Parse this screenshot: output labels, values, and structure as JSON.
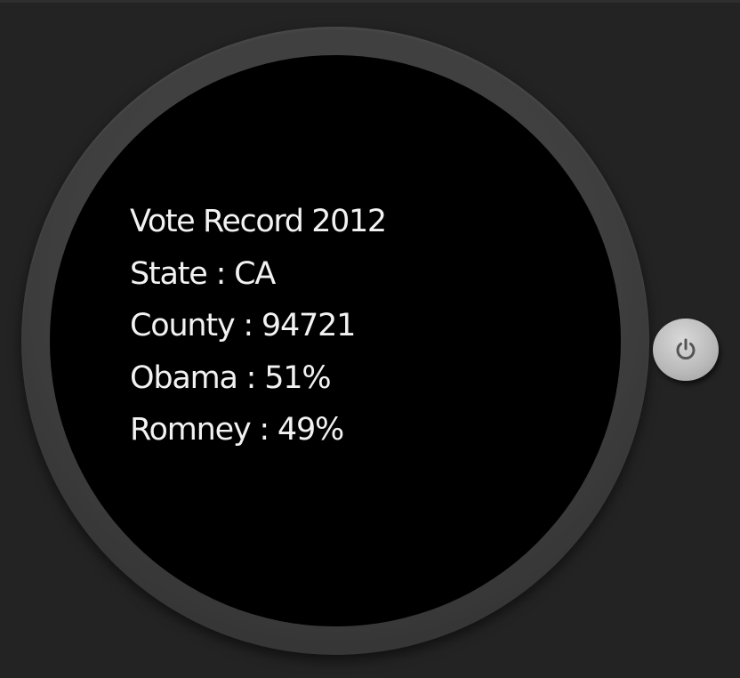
{
  "watch": {
    "lines": [
      "Vote Record 2012",
      "State : CA",
      "County : 94721",
      "Obama : 51%",
      "Romney : 49%"
    ]
  },
  "controls": {
    "power_button_icon": "power-icon"
  },
  "colors": {
    "background": "#232323",
    "bezel": "#404040",
    "screen": "#000000",
    "text": "#f2f2f2",
    "button": "#bdbdbd",
    "button_icon": "#555555"
  }
}
